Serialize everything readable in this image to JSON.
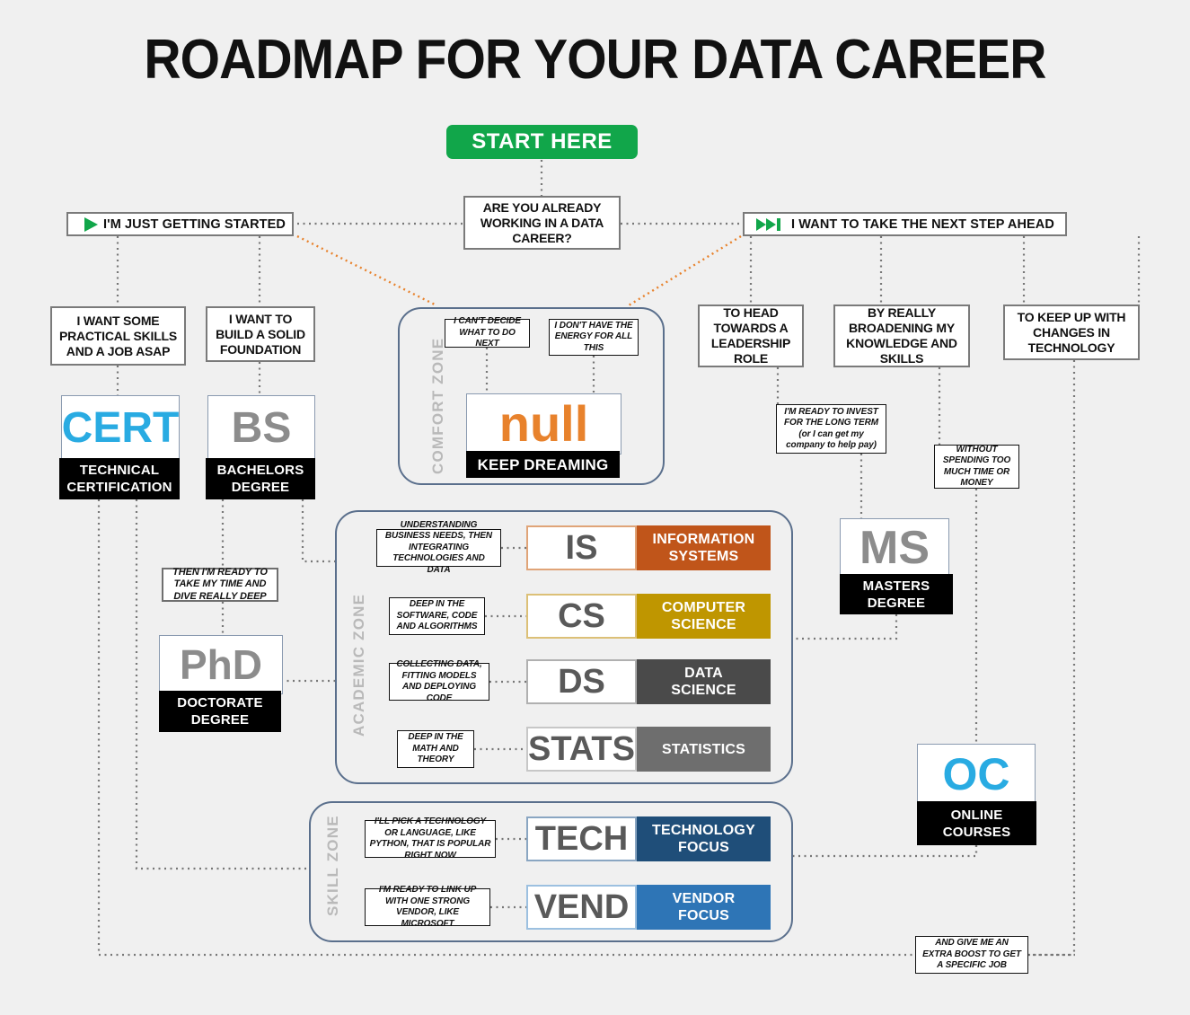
{
  "page": {
    "title": "ROADMAP FOR YOUR DATA CAREER",
    "background": "#f0f0f0"
  },
  "start": {
    "label": "START HERE",
    "color": "#11a64a"
  },
  "decision": {
    "question": "ARE YOU ALREADY WORKING IN A DATA CAREER?"
  },
  "branches": {
    "left": {
      "label": "I'M JUST GETTING STARTED",
      "icon": "play-icon",
      "icon_color": "#11a64a"
    },
    "right": {
      "label": "I WANT TO TAKE THE NEXT STEP AHEAD",
      "icon": "skip-forward-icon",
      "icon_color": "#11a64a"
    }
  },
  "left_choices": [
    {
      "label": "I WANT SOME PRACTICAL SKILLS AND A JOB ASAP"
    },
    {
      "label": "I WANT TO BUILD A SOLID FOUNDATION"
    }
  ],
  "right_choices": [
    {
      "label": "TO HEAD TOWARDS A LEADERSHIP ROLE"
    },
    {
      "label": "BY REALLY BROADENING MY KNOWLEDGE AND SKILLS"
    },
    {
      "label": "TO KEEP UP WITH CHANGES IN TECHNOLOGY"
    }
  ],
  "notes": {
    "cant_decide": "I CAN'T DECIDE WHAT TO DO NEXT",
    "no_energy": "I DON'T HAVE THE ENERGY FOR ALL THIS",
    "dive_deep": "THEN I'M READY TO TAKE MY TIME AND DIVE REALLY DEEP",
    "invest_line1": "I'M READY TO INVEST FOR THE LONG TERM",
    "invest_line2": "(or I can get my company to help pay)",
    "without_spending": "WITHOUT SPENDING TOO MUCH TIME OR MONEY",
    "extra_boost": "AND GIVE ME AN EXTRA BOOST TO GET A SPECIFIC JOB"
  },
  "cards": {
    "cert": {
      "code": "CERT",
      "code_color": "#29abe2",
      "line1": "TECHNICAL",
      "line2": "CERTIFICATION"
    },
    "bs": {
      "code": "BS",
      "code_color": "#8c8c8c",
      "line1": "BACHELORS",
      "line2": "DEGREE"
    },
    "null": {
      "code": "null",
      "code_color": "#e8822c",
      "line1": "KEEP DREAMING",
      "line2": ""
    },
    "phd": {
      "code": "PhD",
      "code_color": "#8c8c8c",
      "line1": "DOCTORATE",
      "line2": "DEGREE"
    },
    "ms": {
      "code": "MS",
      "code_color": "#8c8c8c",
      "line1": "MASTERS",
      "line2": "DEGREE"
    },
    "oc": {
      "code": "OC",
      "code_color": "#29abe2",
      "line1": "ONLINE",
      "line2": "COURSES"
    }
  },
  "zones": {
    "comfort": {
      "label": "COMFORT ZONE"
    },
    "academic": {
      "label": "ACADEMIC ZONE"
    },
    "skill": {
      "label": "SKILL ZONE"
    }
  },
  "academic_programs": [
    {
      "code": "IS",
      "name1": "INFORMATION",
      "name2": "SYSTEMS",
      "color": "#c0551a",
      "border": "#e0a478",
      "note": "UNDERSTANDING BUSINESS NEEDS, THEN INTEGRATING TECHNOLOGIES AND DATA"
    },
    {
      "code": "CS",
      "name1": "COMPUTER",
      "name2": "SCIENCE",
      "color": "#bf9600",
      "border": "#dcc077",
      "note": "DEEP IN THE SOFTWARE, CODE AND ALGORITHMS"
    },
    {
      "code": "DS",
      "name1": "DATA",
      "name2": "SCIENCE",
      "color": "#4a4a4a",
      "border": "#b0b0b0",
      "note": "COLLECTING DATA, FITTING MODELS AND DEPLOYING CODE"
    },
    {
      "code": "STATS",
      "name1": "STATISTICS",
      "name2": "",
      "color": "#6e6e6e",
      "border": "#c7c7c7",
      "note": "DEEP IN THE MATH AND THEORY"
    }
  ],
  "skill_programs": [
    {
      "code": "TECH",
      "name1": "TECHNOLOGY",
      "name2": "FOCUS",
      "color": "#1f4e79",
      "border": "#8aa6c2",
      "note": "I'LL PICK A TECHNOLOGY OR LANGUAGE, LIKE PYTHON, THAT IS POPULAR RIGHT NOW"
    },
    {
      "code": "VEND",
      "name1": "VENDOR",
      "name2": "FOCUS",
      "color": "#2e75b6",
      "border": "#9cc0e0",
      "note": "I'M READY TO LINK UP WITH ONE STRONG VENDOR, LIKE MICROSOFT"
    }
  ]
}
